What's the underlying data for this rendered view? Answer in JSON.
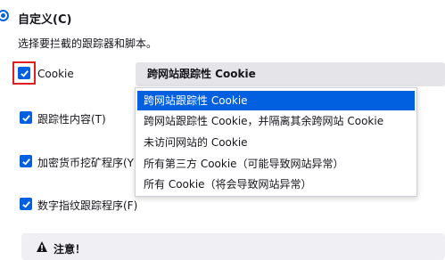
{
  "custom_option": {
    "label": "自定义(C)",
    "description": "选择要拦截的跟踪器和脚本。"
  },
  "options": {
    "cookie": {
      "label": "Cookie",
      "checked": true,
      "dropdown_value": "跨网站跟踪性 Cookie"
    },
    "tracking_content": {
      "label": "跟踪性内容(T)",
      "checked": true
    },
    "cryptominers": {
      "label": "加密货币挖矿程序(Y)",
      "checked": true
    },
    "fingerprinters": {
      "label": "数字指纹跟踪程序(F)",
      "checked": true
    }
  },
  "cookie_menu": {
    "items": [
      "跨网站跟踪性 Cookie",
      "跨网站跟踪性 Cookie，并隔离其余跨网站 Cookie",
      "未访问网站的 Cookie",
      "所有第三方 Cookie（可能导致网站异常）",
      "所有 Cookie（将会导致网站异常）"
    ],
    "selected_index": 0
  },
  "warning": {
    "title": "注意！"
  },
  "colors": {
    "accent": "#0060df",
    "highlight": "#e02020"
  }
}
